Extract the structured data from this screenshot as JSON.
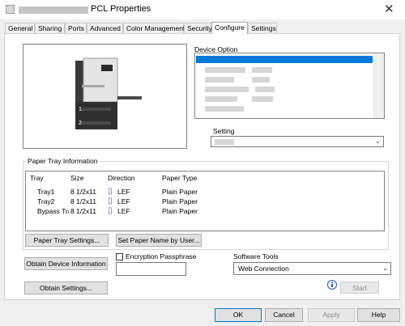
{
  "window": {
    "title": "PCL Properties",
    "close_glyph": "✕"
  },
  "tabs": [
    {
      "label": "General"
    },
    {
      "label": "Sharing"
    },
    {
      "label": "Ports"
    },
    {
      "label": "Advanced"
    },
    {
      "label": "Color Management"
    },
    {
      "label": "Security"
    },
    {
      "label": "Configure",
      "active": true
    },
    {
      "label": "Settings"
    }
  ],
  "device_option": {
    "label": "Device Option"
  },
  "setting": {
    "label": "Setting"
  },
  "paper_tray": {
    "group_label": "Paper Tray Information",
    "columns": [
      "Tray",
      "Size",
      "Direction",
      "Paper Type"
    ],
    "rows": [
      {
        "tray": "Tray1",
        "size": "8 1/2x11",
        "direction": "LEF",
        "type": "Plain Paper"
      },
      {
        "tray": "Tray2",
        "size": "8 1/2x11",
        "direction": "LEF",
        "type": "Plain Paper"
      },
      {
        "tray": "Bypass Tray",
        "size": "8 1/2x11",
        "direction": "LEF",
        "type": "Plain Paper"
      }
    ],
    "settings_button": "Paper Tray Settings...",
    "set_name_button": "Set Paper Name by User..."
  },
  "obtain_device_button": "Obtain Device Information",
  "obtain_settings_button": "Obtain Settings...",
  "encryption_label": "Encryption Passphrase",
  "software_tools": {
    "label": "Software Tools",
    "value": "Web Connection",
    "start_button": "Start"
  },
  "preview": {
    "tray_numbers": [
      "1",
      "2"
    ]
  },
  "footer": {
    "ok": "OK",
    "cancel": "Cancel",
    "apply": "Apply",
    "help": "Help"
  },
  "colors": {
    "accent": "#0078d7"
  }
}
